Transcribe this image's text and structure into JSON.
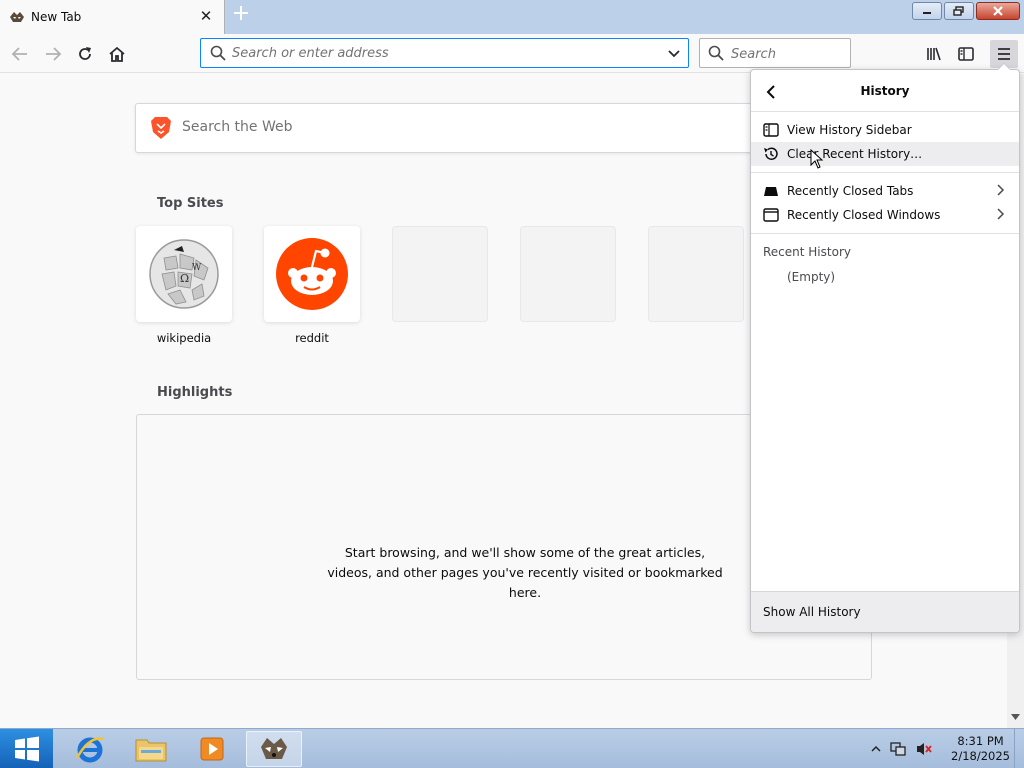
{
  "tab": {
    "title": "New Tab",
    "close_icon": "close-icon"
  },
  "toolbar": {
    "url_placeholder": "Search or enter address",
    "search_placeholder": "Search"
  },
  "newtab": {
    "web_search_placeholder": "Search the Web",
    "top_sites_title": "Top Sites",
    "top_sites": [
      {
        "label": "wikipedia"
      },
      {
        "label": "reddit"
      },
      {
        "label": ""
      },
      {
        "label": ""
      },
      {
        "label": ""
      }
    ],
    "highlights_title": "Highlights",
    "highlights_message": "Start browsing, and we'll show some of the great articles, videos, and other pages you've recently visited or bookmarked here."
  },
  "history_panel": {
    "title": "History",
    "items": [
      {
        "label": "View History Sidebar"
      },
      {
        "label": "Clear Recent History…"
      },
      {
        "label": "Recently Closed Tabs"
      },
      {
        "label": "Recently Closed Windows"
      }
    ],
    "recent_heading": "Recent History",
    "recent_empty": "(Empty)",
    "footer": "Show All History"
  },
  "taskbar": {
    "time": "8:31 PM",
    "date": "2/18/2025"
  },
  "colors": {
    "accent": "#0a84ff",
    "reddit": "#ff4500",
    "brave": "#fb542b",
    "start": "#1e7ad0"
  }
}
